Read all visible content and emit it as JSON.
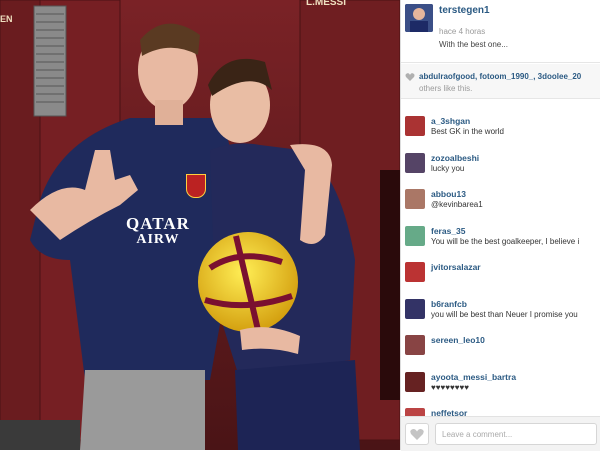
{
  "post": {
    "username": "terstegen1",
    "time": "hace 4 horas",
    "caption": "With the best one..."
  },
  "photo": {
    "jersey_sponsor_line1": "QATAR",
    "jersey_sponsor_line2": "AIRW",
    "locker_name": "L.MESSI",
    "locker_label": "EN"
  },
  "likes": {
    "users": "abdulraofgood, fotoom_1990_, 3doolee_20",
    "suffix": "others like this."
  },
  "comments": [
    {
      "user": "a_3shgan",
      "text": "Best GK in the world",
      "avatar_color": "#a33"
    },
    {
      "user": "zozoalbeshi",
      "text": "lucky you",
      "avatar_color": "#546"
    },
    {
      "user": "abbou13",
      "text": "@kevinbarea1",
      "avatar_color": "#a76"
    },
    {
      "user": "feras_35",
      "text": "You will be the best goalkeeper, I believe i",
      "avatar_color": "#6a8"
    },
    {
      "user": "jvitorsalazar",
      "text": "",
      "avatar_color": "#b33"
    },
    {
      "user": "b6ranfcb",
      "text": "you will be best than Neuer I promise you",
      "avatar_color": "#336"
    },
    {
      "user": "sereen_leo10",
      "text": "",
      "avatar_color": "#844"
    },
    {
      "user": "ayoota_messi_bartra",
      "text": "♥♥♥♥♥♥♥♥",
      "avatar_color": "#622"
    },
    {
      "user": "neffetsor",
      "text": "",
      "avatar_color": "#b44"
    }
  ],
  "footer": {
    "comment_placeholder": "Leave a comment..."
  },
  "colors": {
    "link": "#2b5a83",
    "locker": "#6b1f22"
  }
}
